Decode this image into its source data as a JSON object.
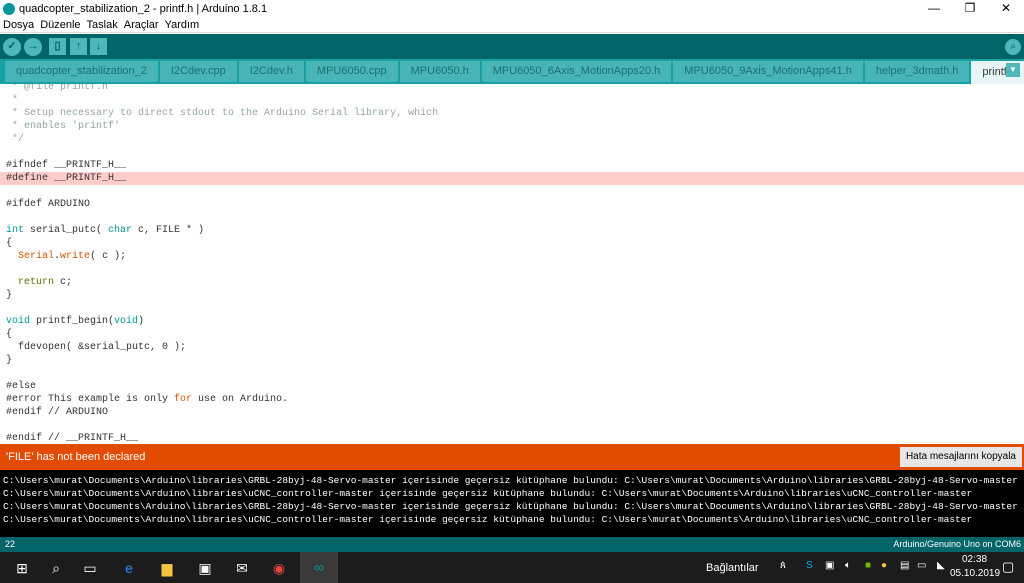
{
  "window": {
    "title": "quadcopter_stabilization_2 - printf.h | Arduino 1.8.1",
    "minimize": "—",
    "maximize": "❐",
    "close": "✕"
  },
  "menu": [
    "Dosya",
    "Düzenle",
    "Taslak",
    "Araçlar",
    "Yardım"
  ],
  "tabs": [
    "quadcopter_stabilization_2",
    "I2Cdev.cpp",
    "I2Cdev.h",
    "MPU6050.cpp",
    "MPU6050.h",
    "MPU6050_6Axis_MotionApps20.h",
    "MPU6050_9Axis_MotionApps41.h",
    "helper_3dmath.h",
    "printf.h"
  ],
  "active_tab": "printf.h",
  "code": {
    "l0": " * @file printf.h",
    "l1": " *",
    "l2": " * Setup necessary to direct stdout to the Arduino Serial library, which",
    "l3": " * enables 'printf'",
    "l4": " */",
    "l6": "#ifndef __PRINTF_H__",
    "l7": "#define __PRINTF_H__",
    "l9": "#ifdef ARDUINO",
    "l11a": "int",
    "l11b": " serial_putc( ",
    "l11c": "char",
    "l11d": " c, FILE * )",
    "l12": "{",
    "l13a": "  ",
    "l13b": "Serial",
    "l13c": ".",
    "l13d": "write",
    "l13e": "( c );",
    "l15a": "  ",
    "l15b": "return",
    "l15c": " c;",
    "l16": "}",
    "l18a": "void",
    "l18b": " printf_begin(",
    "l18c": "void",
    "l18d": ")",
    "l19": "{",
    "l20": "  fdevopen( &serial_putc, 0 );",
    "l21": "}",
    "l23": "#else",
    "l24a": "#error This example is only ",
    "l24b": "for",
    "l24c": " use on Arduino.",
    "l25": "#endif // ARDUINO",
    "l27": "#endif // __PRINTF_H__"
  },
  "error": {
    "message": "'FILE' has not been declared",
    "copy_button": "Hata mesajlarını kopyala"
  },
  "console": [
    "C:\\Users\\murat\\Documents\\Arduino\\libraries\\GRBL-28byj-48-Servo-master içerisinde geçersiz kütüphane bulundu: C:\\Users\\murat\\Documents\\Arduino\\libraries\\GRBL-28byj-48-Servo-master",
    "C:\\Users\\murat\\Documents\\Arduino\\libraries\\uCNC_controller-master içerisinde geçersiz kütüphane bulundu: C:\\Users\\murat\\Documents\\Arduino\\libraries\\uCNC_controller-master",
    "C:\\Users\\murat\\Documents\\Arduino\\libraries\\GRBL-28byj-48-Servo-master içerisinde geçersiz kütüphane bulundu: C:\\Users\\murat\\Documents\\Arduino\\libraries\\GRBL-28byj-48-Servo-master",
    "C:\\Users\\murat\\Documents\\Arduino\\libraries\\uCNC_controller-master içerisinde geçersiz kütüphane bulundu: C:\\Users\\murat\\Documents\\Arduino\\libraries\\uCNC_controller-master"
  ],
  "status": {
    "line": "22",
    "board": "Arduino/Genuino Uno on COM6"
  },
  "taskbar": {
    "connections": "Bağlantılar",
    "time": "02:38",
    "date": "05.10.2019"
  }
}
